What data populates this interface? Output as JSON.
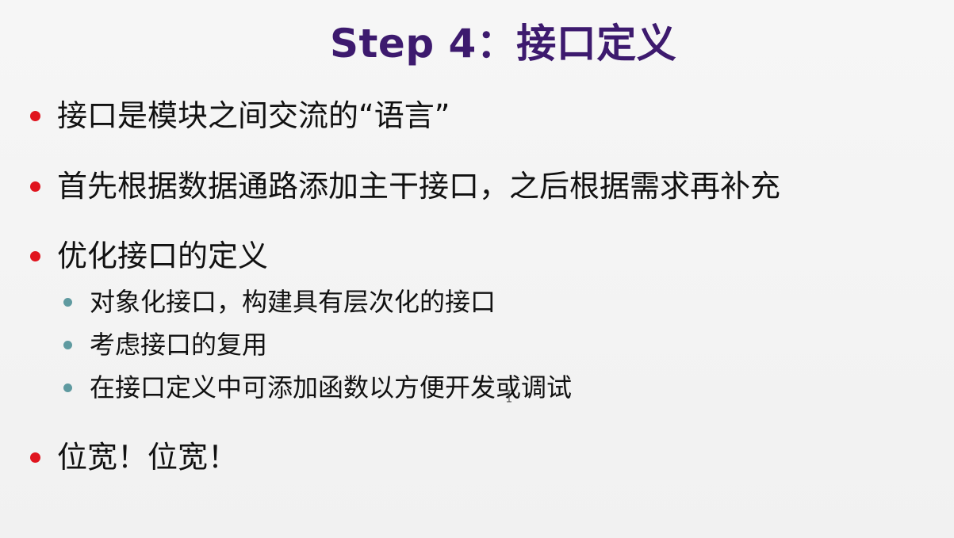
{
  "slide": {
    "title": "Step 4：接口定义",
    "bullets": [
      {
        "text": "接口是模块之间交流的“语言”"
      },
      {
        "text": "首先根据数据通路添加主干接口，之后根据需求再补充"
      },
      {
        "text": "优化接口的定义"
      },
      {
        "text": "位宽！位宽！"
      }
    ],
    "sub_bullets": [
      {
        "text": "对象化接口，构建具有层次化的接口"
      },
      {
        "text": "考虑接口的复用"
      },
      {
        "text": "在接口定义中可添加函数以方便开发或调试"
      }
    ]
  },
  "colors": {
    "title": "#3d1a6e",
    "bullet_primary": "#e0141e",
    "bullet_secondary": "#5f9aa0"
  }
}
